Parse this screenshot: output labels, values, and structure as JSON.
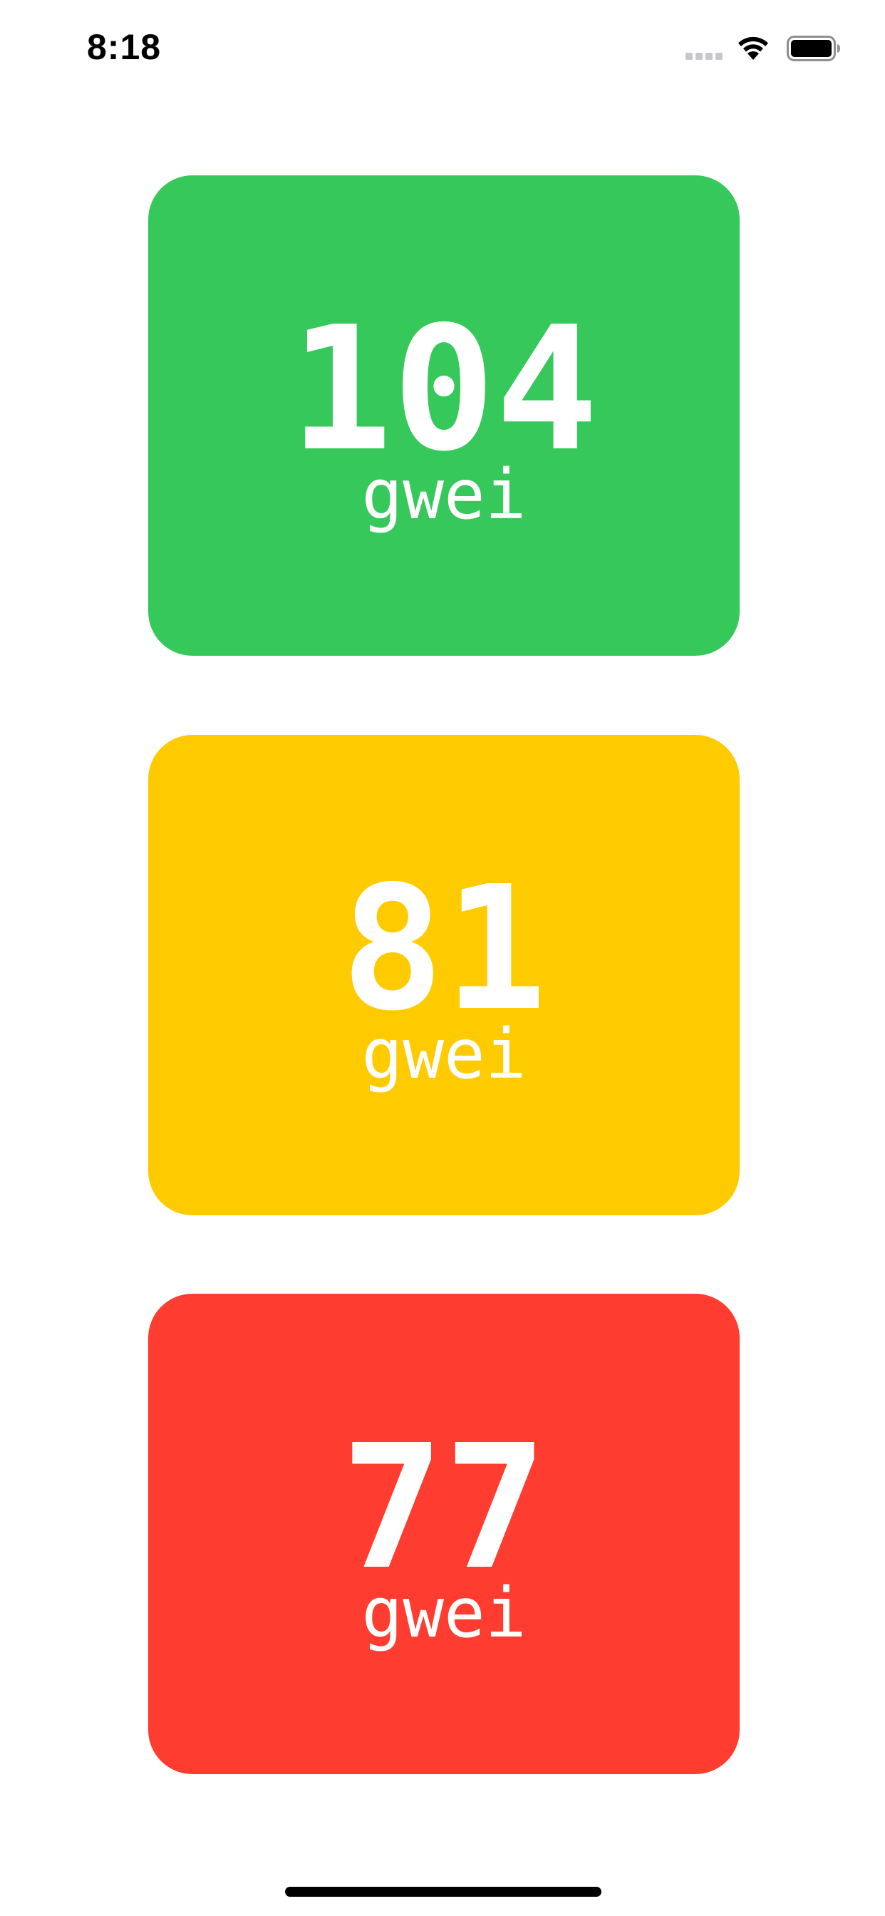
{
  "status_bar": {
    "time": "8:18"
  },
  "cards": [
    {
      "value": "104",
      "unit": "gwei",
      "color": "#37C85B"
    },
    {
      "value": "81",
      "unit": "gwei",
      "color": "#FECB00"
    },
    {
      "value": "77",
      "unit": "gwei",
      "color": "#FF3C30"
    }
  ],
  "icons": {
    "signal": "cellular-signal-icon",
    "wifi": "wifi-icon",
    "battery": "battery-icon"
  }
}
